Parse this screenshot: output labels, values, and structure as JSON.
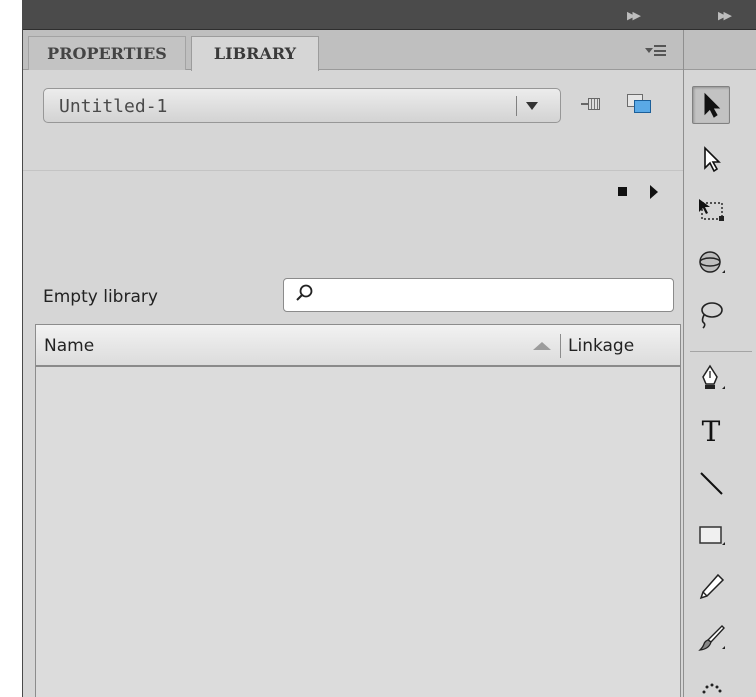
{
  "tabs": [
    {
      "label": "PROPERTIES",
      "active": false
    },
    {
      "label": "LIBRARY",
      "active": true
    }
  ],
  "library": {
    "document_select": "Untitled-1",
    "status_text": "Empty library",
    "search_value": "",
    "columns": {
      "name": "Name",
      "linkage": "Linkage"
    },
    "items": []
  },
  "icons": {
    "panel_menu": "panel-menu-icon",
    "pin": "pin-library-icon",
    "new_library_panel": "new-library-panel-icon",
    "stop": "stop-icon",
    "play": "play-icon",
    "search": "magnifier-icon",
    "collapse": "double-chevron-right-icon"
  },
  "tools": [
    {
      "name": "selection-tool",
      "selected": true
    },
    {
      "name": "subselection-tool",
      "selected": false
    },
    {
      "name": "free-transform-tool",
      "selected": false
    },
    {
      "name": "3d-rotation-tool",
      "selected": false
    },
    {
      "name": "lasso-tool",
      "selected": false
    },
    {
      "name": "pen-tool",
      "selected": false
    },
    {
      "name": "text-tool",
      "selected": false
    },
    {
      "name": "line-tool",
      "selected": false
    },
    {
      "name": "rectangle-tool",
      "selected": false
    },
    {
      "name": "pencil-tool",
      "selected": false
    },
    {
      "name": "brush-tool",
      "selected": false
    },
    {
      "name": "deco-tool",
      "selected": false
    }
  ],
  "colors": {
    "topbar": "#4b4b4b",
    "panel_bg": "#d6d6d6",
    "tabbar_bg": "#bfbfbf",
    "new_library_accent": "#5aa9e6"
  }
}
